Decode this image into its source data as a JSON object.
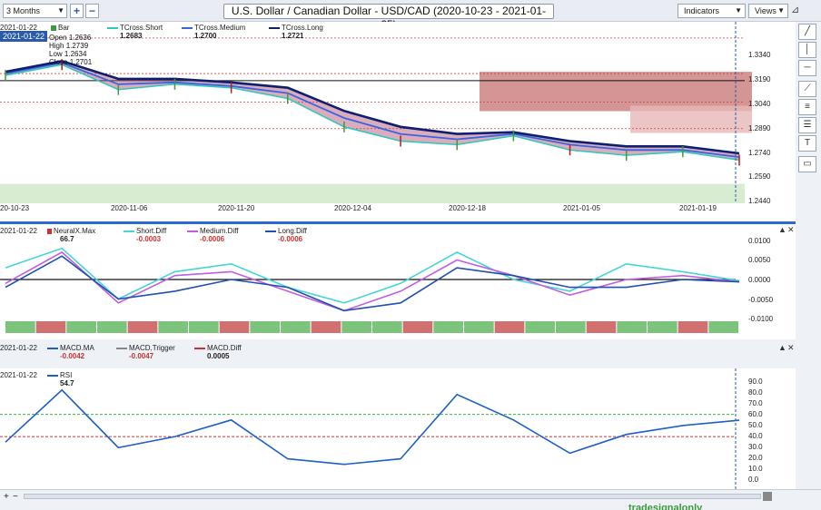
{
  "toolbar": {
    "period": "3 Months",
    "title": "U.S. Dollar / Canadian Dollar - USD/CAD (2020-10-23 - 2021-01-25)",
    "indicators_label": "Indicators",
    "views_label": "Views",
    "zoom_in_icon": "plus-icon",
    "zoom_out_icon": "minus-icon"
  },
  "price_pane": {
    "date": "2021-01-22",
    "badge": "2021-01-22",
    "bar_label": "Bar",
    "ohlc": {
      "open_label": "Open",
      "open": "1.2636",
      "high_label": "High",
      "high": "1.2739",
      "low_label": "Low",
      "low": "1.2634",
      "close_label": "Close",
      "close": "1.2701"
    },
    "legend": [
      {
        "name": "TCross.Short",
        "value": "1.2683",
        "color": "#2bc8b8"
      },
      {
        "name": "TCross.Medium",
        "value": "1.2700",
        "color": "#3a64e0"
      },
      {
        "name": "TCross.Long",
        "value": "1.2721",
        "color": "#0d1f6e"
      }
    ],
    "y_ticks": [
      "1.3340",
      "1.3190",
      "1.3040",
      "1.2890",
      "1.2740",
      "1.2590",
      "1.2440"
    ],
    "x_ticks": [
      "20-10-23",
      "2020-11-06",
      "2020-11-20",
      "2020-12-04",
      "2020-12-18",
      "2021-01-05",
      "2021-01-19"
    ]
  },
  "diff_pane": {
    "date": "2021-01-22",
    "legend": [
      {
        "name": "NeuralX.Max",
        "value": "66.7",
        "color": "#333333"
      },
      {
        "name": "Short.Diff",
        "value": "-0.0003",
        "color": "#44d6d6"
      },
      {
        "name": "Medium.Diff",
        "value": "-0.0006",
        "color": "#c25ee0"
      },
      {
        "name": "Long.Diff",
        "value": "-0.0006",
        "color": "#2050b0"
      }
    ],
    "y_ticks": [
      "0.0100",
      "0.0050",
      "0.0000",
      "-0.0050",
      "-0.0100"
    ]
  },
  "macd_pane": {
    "date": "2021-01-22",
    "legend": [
      {
        "name": "MACD.MA",
        "value": "-0.0042",
        "color": "#1e5fc8"
      },
      {
        "name": "MACD.Trigger",
        "value": "-0.0047",
        "color": "#888888"
      },
      {
        "name": "MACD.Diff",
        "value": "0.0005",
        "color": "#c83232"
      }
    ]
  },
  "rsi_pane": {
    "date": "2021-01-22",
    "legend": [
      {
        "name": "RSI",
        "value": "54.7",
        "color": "#1e5fc8"
      }
    ],
    "y_ticks": [
      "90.0",
      "80.0",
      "70.0",
      "60.0",
      "50.0",
      "40.0",
      "30.0",
      "20.0",
      "10.0",
      "0.0"
    ]
  },
  "statusbar": {
    "brand": "tradesignalonly"
  },
  "chart_data": [
    {
      "type": "line",
      "title": "U.S. Dollar / Canadian Dollar - USD/CAD (2020-10-23 - 2021-01-25)",
      "x": [
        "2020-10-23",
        "2020-10-30",
        "2020-11-06",
        "2020-11-13",
        "2020-11-20",
        "2020-11-27",
        "2020-12-04",
        "2020-12-11",
        "2020-12-18",
        "2020-12-25",
        "2021-01-05",
        "2021-01-12",
        "2021-01-19",
        "2021-01-22"
      ],
      "series": [
        {
          "name": "TCross.Short",
          "values": [
            1.316,
            1.322,
            1.308,
            1.311,
            1.309,
            1.303,
            1.287,
            1.279,
            1.277,
            1.282,
            1.274,
            1.271,
            1.273,
            1.2683
          ]
        },
        {
          "name": "TCross.Medium",
          "values": [
            1.317,
            1.323,
            1.311,
            1.312,
            1.31,
            1.306,
            1.292,
            1.283,
            1.28,
            1.283,
            1.277,
            1.274,
            1.274,
            1.27
          ]
        },
        {
          "name": "TCross.Long",
          "values": [
            1.318,
            1.324,
            1.314,
            1.314,
            1.312,
            1.309,
            1.296,
            1.287,
            1.283,
            1.284,
            1.279,
            1.276,
            1.276,
            1.2721
          ]
        }
      ],
      "ylim": [
        1.244,
        1.34
      ]
    },
    {
      "type": "line",
      "x": [
        "2020-10-23",
        "2020-10-30",
        "2020-11-06",
        "2020-11-13",
        "2020-11-20",
        "2020-11-27",
        "2020-12-04",
        "2020-12-11",
        "2020-12-18",
        "2020-12-25",
        "2021-01-05",
        "2021-01-12",
        "2021-01-19",
        "2021-01-22"
      ],
      "series": [
        {
          "name": "Short.Diff",
          "values": [
            0.003,
            0.008,
            -0.005,
            0.002,
            0.004,
            -0.002,
            -0.006,
            -0.001,
            0.007,
            0.0,
            -0.003,
            0.004,
            0.002,
            -0.0003
          ]
        },
        {
          "name": "Medium.Diff",
          "values": [
            -0.001,
            0.007,
            -0.006,
            0.001,
            0.002,
            -0.003,
            -0.008,
            -0.003,
            0.005,
            0.001,
            -0.004,
            0.0,
            0.001,
            -0.0006
          ]
        },
        {
          "name": "Long.Diff",
          "values": [
            -0.002,
            0.006,
            -0.005,
            -0.003,
            0.0,
            -0.002,
            -0.008,
            -0.006,
            0.003,
            0.001,
            -0.002,
            -0.002,
            0.0,
            -0.0006
          ]
        }
      ],
      "ylim": [
        -0.01,
        0.01
      ]
    },
    {
      "type": "line",
      "x": [
        "2020-10-23",
        "2020-10-30",
        "2020-11-06",
        "2020-11-13",
        "2020-11-20",
        "2020-11-27",
        "2020-12-04",
        "2020-12-11",
        "2020-12-18",
        "2020-12-25",
        "2021-01-05",
        "2021-01-12",
        "2021-01-19",
        "2021-01-22"
      ],
      "series": [
        {
          "name": "RSI",
          "values": [
            35,
            82,
            30,
            40,
            55,
            20,
            15,
            20,
            78,
            55,
            25,
            42,
            50,
            54.7
          ]
        }
      ],
      "ylim": [
        0,
        90
      ]
    }
  ]
}
